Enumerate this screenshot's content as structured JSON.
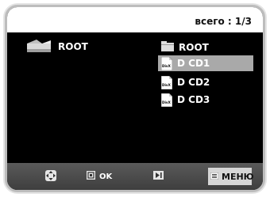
{
  "header": {
    "page_count": "всего : 1/3"
  },
  "left_pane": {
    "folder_label": "ROOT",
    "folder_icon": "open-folder-icon"
  },
  "right_pane": {
    "folder_label": "ROOT",
    "folder_icon": "folder-icon",
    "files": [
      {
        "label": "D CD1",
        "icon": "divx-file-icon",
        "icon_text": "DivX",
        "selected": true
      },
      {
        "label": "D CD2",
        "icon": "divx-file-icon",
        "icon_text": "DivX",
        "selected": false
      },
      {
        "label": "D CD3",
        "icon": "divx-file-icon",
        "icon_text": "DivX",
        "selected": false
      }
    ]
  },
  "footer": {
    "navigate_icon": "dpad-icon",
    "ok_icon": "enter-icon",
    "ok_label": "OK",
    "skip_icon": "play-skip-icon",
    "menu_icon": "menu-icon",
    "menu_label": "МЕНЮ"
  },
  "colors": {
    "background": "#000000",
    "header": "#ffffff",
    "selection": "#a9a9a9",
    "footer": "#4a4a4a",
    "frame": "#bdbdbd"
  }
}
